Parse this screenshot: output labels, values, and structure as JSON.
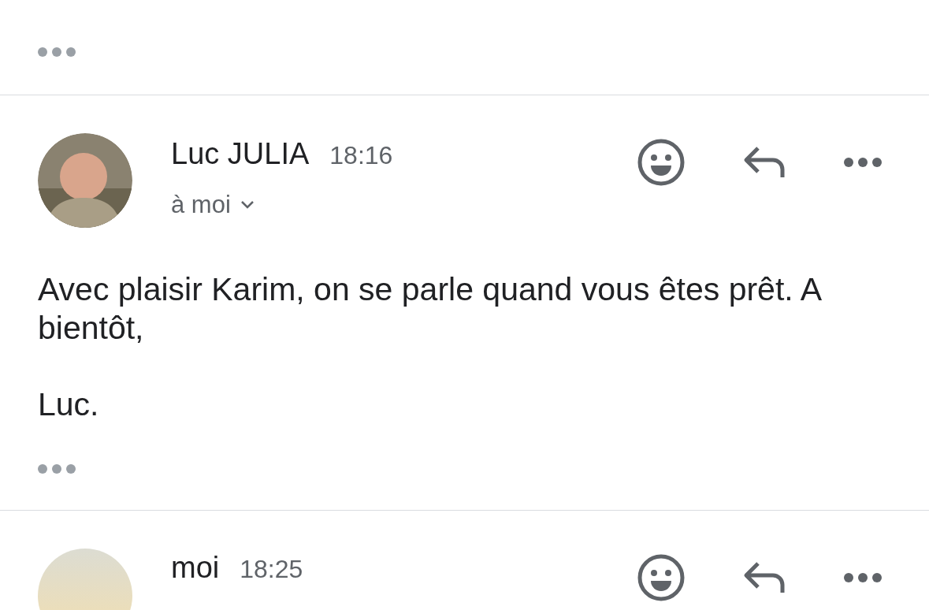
{
  "messages": [
    {
      "kind": "trimmed"
    },
    {
      "kind": "open",
      "sender": "Luc JULIA",
      "time": "18:16",
      "recipient": "à moi",
      "body": [
        "Avec plaisir Karim, on se parle quand vous êtes prêt. A bientôt,",
        "Luc."
      ]
    },
    {
      "kind": "header",
      "sender": "moi",
      "time": "18:25"
    }
  ]
}
